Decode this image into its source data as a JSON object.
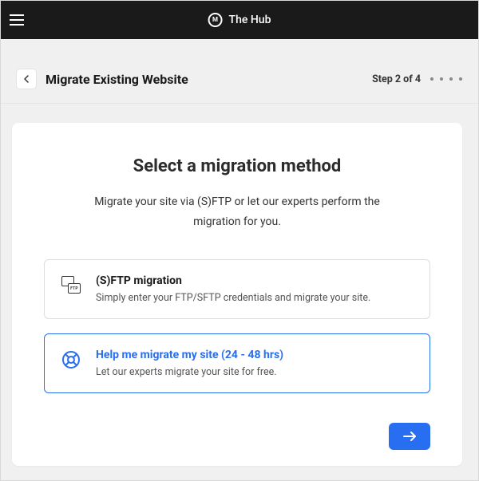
{
  "brand": {
    "name": "The Hub",
    "icon_letter": "M"
  },
  "header": {
    "title": "Migrate Existing Website",
    "step_label": "Step 2 of 4"
  },
  "card": {
    "heading": "Select a migration method",
    "subtitle": "Migrate your site via (S)FTP or let our experts perform the migration for you."
  },
  "options": {
    "sftp": {
      "title": "(S)FTP migration",
      "desc": "Simply enter your FTP/SFTP credentials and migrate your site.",
      "badge": "FTP"
    },
    "help": {
      "title": "Help me migrate my site (24 - 48 hrs)",
      "desc": "Let our experts migrate your site for free."
    }
  }
}
